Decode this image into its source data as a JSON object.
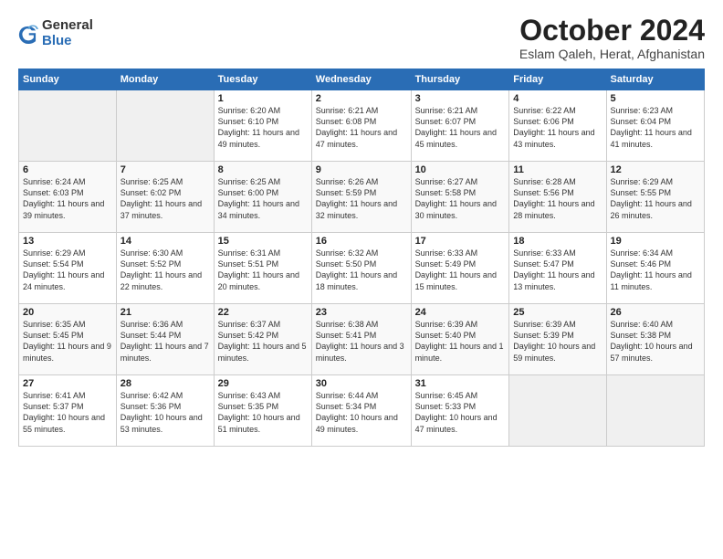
{
  "logo": {
    "general": "General",
    "blue": "Blue"
  },
  "title": "October 2024",
  "location": "Eslam Qaleh, Herat, Afghanistan",
  "headers": [
    "Sunday",
    "Monday",
    "Tuesday",
    "Wednesday",
    "Thursday",
    "Friday",
    "Saturday"
  ],
  "weeks": [
    [
      {
        "num": "",
        "detail": ""
      },
      {
        "num": "",
        "detail": ""
      },
      {
        "num": "1",
        "detail": "Sunrise: 6:20 AM\nSunset: 6:10 PM\nDaylight: 11 hours and 49 minutes."
      },
      {
        "num": "2",
        "detail": "Sunrise: 6:21 AM\nSunset: 6:08 PM\nDaylight: 11 hours and 47 minutes."
      },
      {
        "num": "3",
        "detail": "Sunrise: 6:21 AM\nSunset: 6:07 PM\nDaylight: 11 hours and 45 minutes."
      },
      {
        "num": "4",
        "detail": "Sunrise: 6:22 AM\nSunset: 6:06 PM\nDaylight: 11 hours and 43 minutes."
      },
      {
        "num": "5",
        "detail": "Sunrise: 6:23 AM\nSunset: 6:04 PM\nDaylight: 11 hours and 41 minutes."
      }
    ],
    [
      {
        "num": "6",
        "detail": "Sunrise: 6:24 AM\nSunset: 6:03 PM\nDaylight: 11 hours and 39 minutes."
      },
      {
        "num": "7",
        "detail": "Sunrise: 6:25 AM\nSunset: 6:02 PM\nDaylight: 11 hours and 37 minutes."
      },
      {
        "num": "8",
        "detail": "Sunrise: 6:25 AM\nSunset: 6:00 PM\nDaylight: 11 hours and 34 minutes."
      },
      {
        "num": "9",
        "detail": "Sunrise: 6:26 AM\nSunset: 5:59 PM\nDaylight: 11 hours and 32 minutes."
      },
      {
        "num": "10",
        "detail": "Sunrise: 6:27 AM\nSunset: 5:58 PM\nDaylight: 11 hours and 30 minutes."
      },
      {
        "num": "11",
        "detail": "Sunrise: 6:28 AM\nSunset: 5:56 PM\nDaylight: 11 hours and 28 minutes."
      },
      {
        "num": "12",
        "detail": "Sunrise: 6:29 AM\nSunset: 5:55 PM\nDaylight: 11 hours and 26 minutes."
      }
    ],
    [
      {
        "num": "13",
        "detail": "Sunrise: 6:29 AM\nSunset: 5:54 PM\nDaylight: 11 hours and 24 minutes."
      },
      {
        "num": "14",
        "detail": "Sunrise: 6:30 AM\nSunset: 5:52 PM\nDaylight: 11 hours and 22 minutes."
      },
      {
        "num": "15",
        "detail": "Sunrise: 6:31 AM\nSunset: 5:51 PM\nDaylight: 11 hours and 20 minutes."
      },
      {
        "num": "16",
        "detail": "Sunrise: 6:32 AM\nSunset: 5:50 PM\nDaylight: 11 hours and 18 minutes."
      },
      {
        "num": "17",
        "detail": "Sunrise: 6:33 AM\nSunset: 5:49 PM\nDaylight: 11 hours and 15 minutes."
      },
      {
        "num": "18",
        "detail": "Sunrise: 6:33 AM\nSunset: 5:47 PM\nDaylight: 11 hours and 13 minutes."
      },
      {
        "num": "19",
        "detail": "Sunrise: 6:34 AM\nSunset: 5:46 PM\nDaylight: 11 hours and 11 minutes."
      }
    ],
    [
      {
        "num": "20",
        "detail": "Sunrise: 6:35 AM\nSunset: 5:45 PM\nDaylight: 11 hours and 9 minutes."
      },
      {
        "num": "21",
        "detail": "Sunrise: 6:36 AM\nSunset: 5:44 PM\nDaylight: 11 hours and 7 minutes."
      },
      {
        "num": "22",
        "detail": "Sunrise: 6:37 AM\nSunset: 5:42 PM\nDaylight: 11 hours and 5 minutes."
      },
      {
        "num": "23",
        "detail": "Sunrise: 6:38 AM\nSunset: 5:41 PM\nDaylight: 11 hours and 3 minutes."
      },
      {
        "num": "24",
        "detail": "Sunrise: 6:39 AM\nSunset: 5:40 PM\nDaylight: 11 hours and 1 minute."
      },
      {
        "num": "25",
        "detail": "Sunrise: 6:39 AM\nSunset: 5:39 PM\nDaylight: 10 hours and 59 minutes."
      },
      {
        "num": "26",
        "detail": "Sunrise: 6:40 AM\nSunset: 5:38 PM\nDaylight: 10 hours and 57 minutes."
      }
    ],
    [
      {
        "num": "27",
        "detail": "Sunrise: 6:41 AM\nSunset: 5:37 PM\nDaylight: 10 hours and 55 minutes."
      },
      {
        "num": "28",
        "detail": "Sunrise: 6:42 AM\nSunset: 5:36 PM\nDaylight: 10 hours and 53 minutes."
      },
      {
        "num": "29",
        "detail": "Sunrise: 6:43 AM\nSunset: 5:35 PM\nDaylight: 10 hours and 51 minutes."
      },
      {
        "num": "30",
        "detail": "Sunrise: 6:44 AM\nSunset: 5:34 PM\nDaylight: 10 hours and 49 minutes."
      },
      {
        "num": "31",
        "detail": "Sunrise: 6:45 AM\nSunset: 5:33 PM\nDaylight: 10 hours and 47 minutes."
      },
      {
        "num": "",
        "detail": ""
      },
      {
        "num": "",
        "detail": ""
      }
    ]
  ]
}
